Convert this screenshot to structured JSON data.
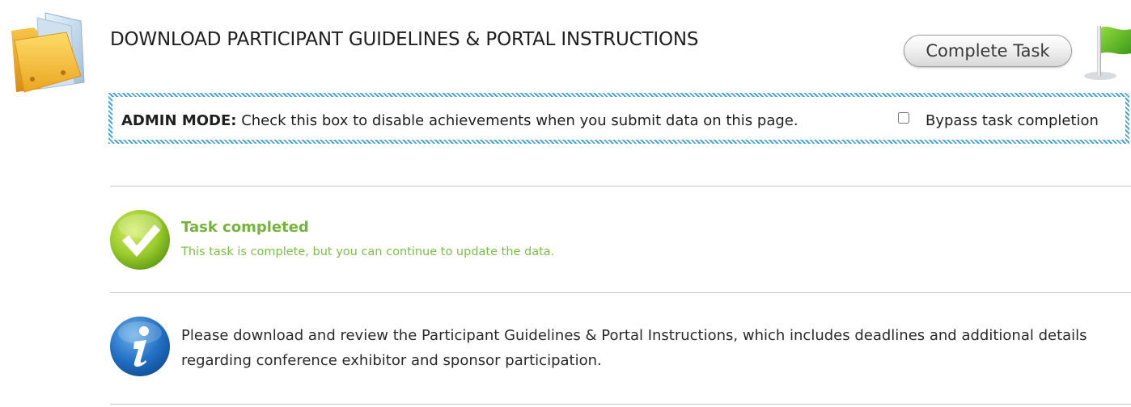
{
  "header": {
    "title": "DOWNLOAD PARTICIPANT GUIDELINES & PORTAL INSTRUCTIONS",
    "complete_button_label": "Complete Task",
    "folder_icon": "folder-icon",
    "flag_icon": "flag-icon"
  },
  "admin_mode": {
    "label": "ADMIN MODE:",
    "text": " Check this box to disable achievements when you submit data on this page.",
    "checkbox_label": "Bypass task completion",
    "checkbox_checked": false,
    "border_color": "#4aa6d6"
  },
  "task_status": {
    "icon": "checkmark-icon",
    "heading": "Task completed",
    "message": "This task is complete, but you can continue to update the data.",
    "color": "#74b43a"
  },
  "info": {
    "icon": "info-icon",
    "message": "Please download and review the Participant Guidelines & Portal Instructions, which includes deadlines and additional details regarding conference exhibitor and sponsor participation."
  }
}
